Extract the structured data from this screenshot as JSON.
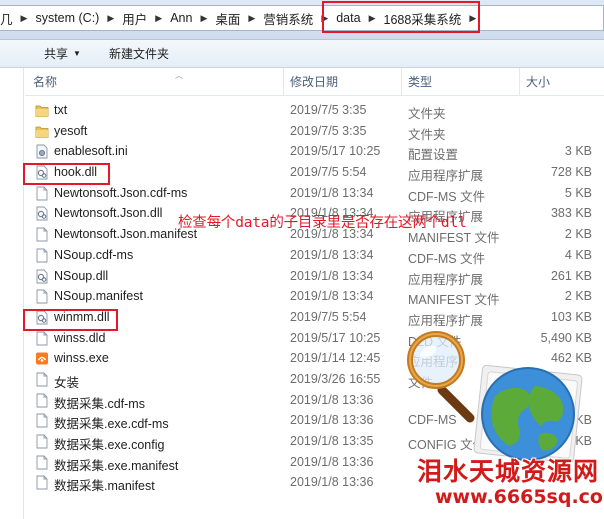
{
  "breadcrumb": {
    "items": [
      "system (C:)",
      "用户",
      "Ann",
      "桌面",
      "营销系统",
      "data",
      "1688采集系统"
    ]
  },
  "toolbar": {
    "share_label": "共享",
    "new_folder_label": "新建文件夹"
  },
  "columns": {
    "name": "名称",
    "date": "修改日期",
    "type": "类型",
    "size": "大小"
  },
  "files": [
    {
      "name": "txt",
      "date": "2019/7/5 3:35",
      "type": "文件夹",
      "size": "",
      "icon": "folder-icon"
    },
    {
      "name": "yesoft",
      "date": "2019/7/5 3:35",
      "type": "文件夹",
      "size": "",
      "icon": "folder-icon"
    },
    {
      "name": "enablesoft.ini",
      "date": "2019/5/17 10:25",
      "type": "配置设置",
      "size": "3 KB",
      "icon": "config-file-icon"
    },
    {
      "name": "hook.dll",
      "date": "2019/7/5 5:54",
      "type": "应用程序扩展",
      "size": "728 KB",
      "icon": "dll-file-icon"
    },
    {
      "name": "Newtonsoft.Json.cdf-ms",
      "date": "2019/1/8 13:34",
      "type": "CDF-MS 文件",
      "size": "5 KB",
      "icon": "file-icon"
    },
    {
      "name": "Newtonsoft.Json.dll",
      "date": "2019/1/8 13:34",
      "type": "应用程序扩展",
      "size": "383 KB",
      "icon": "dll-file-icon"
    },
    {
      "name": "Newtonsoft.Json.manifest",
      "date": "2019/1/8 13:34",
      "type": "MANIFEST 文件",
      "size": "2 KB",
      "icon": "file-icon"
    },
    {
      "name": "NSoup.cdf-ms",
      "date": "2019/1/8 13:34",
      "type": "CDF-MS 文件",
      "size": "4 KB",
      "icon": "file-icon"
    },
    {
      "name": "NSoup.dll",
      "date": "2019/1/8 13:34",
      "type": "应用程序扩展",
      "size": "261 KB",
      "icon": "dll-file-icon"
    },
    {
      "name": "NSoup.manifest",
      "date": "2019/1/8 13:34",
      "type": "MANIFEST 文件",
      "size": "2 KB",
      "icon": "file-icon"
    },
    {
      "name": "winmm.dll",
      "date": "2019/7/5 5:54",
      "type": "应用程序扩展",
      "size": "103 KB",
      "icon": "dll-file-icon"
    },
    {
      "name": "winss.dld",
      "date": "2019/5/17 10:25",
      "type": "DLD 文件",
      "size": "5,490 KB",
      "icon": "file-icon"
    },
    {
      "name": "winss.exe",
      "date": "2019/1/14 12:45",
      "type": "应用程序",
      "size": "462 KB",
      "icon": "exe-app-icon"
    },
    {
      "name": "女装",
      "date": "2019/3/26 16:55",
      "type": "文件",
      "size": "",
      "icon": "file-icon"
    },
    {
      "name": "数据采集.cdf-ms",
      "date": "2019/1/8 13:36",
      "type": "",
      "size": "",
      "icon": "file-icon"
    },
    {
      "name": "数据采集.exe.cdf-ms",
      "date": "2019/1/8 13:36",
      "type": "CDF-MS",
      "size": "15 KB",
      "icon": "file-icon"
    },
    {
      "name": "数据采集.exe.config",
      "date": "2019/1/8 13:35",
      "type": "CONFIG 文件",
      "size": "1 KB",
      "icon": "file-icon"
    },
    {
      "name": "数据采集.exe.manifest",
      "date": "2019/1/8 13:36",
      "type": "",
      "size": "",
      "icon": "file-icon"
    },
    {
      "name": "数据采集.manifest",
      "date": "2019/1/8 13:36",
      "type": "",
      "size": "",
      "icon": "file-icon"
    }
  ],
  "annotation": {
    "text": "检查每个data的子目录里是否存在这两个dll",
    "color": "#e3192b"
  },
  "watermark": {
    "title": "泪水天城资源网",
    "url": "www.6665sq.com"
  },
  "colors": {
    "highlight_red": "#e3192b",
    "folder_yellow": "#e8c25a",
    "header_text": "#4c607a"
  }
}
